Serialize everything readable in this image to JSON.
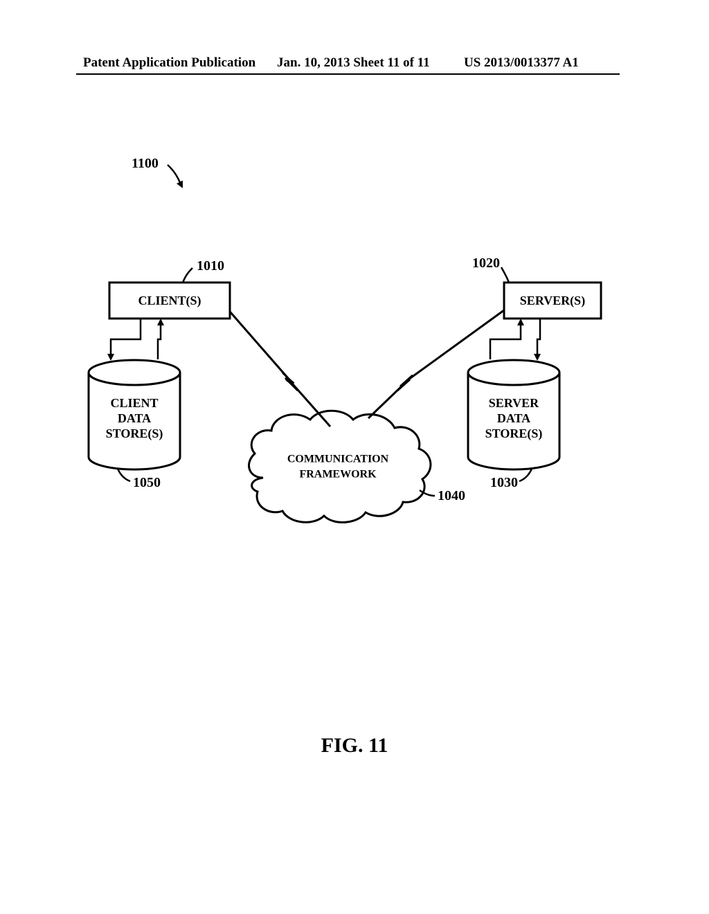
{
  "header": {
    "left": "Patent Application Publication",
    "mid": "Jan. 10, 2013  Sheet 11 of 11",
    "right": "US 2013/0013377 A1"
  },
  "figure": {
    "caption": "FIG.  11",
    "refs": {
      "overall": "1100",
      "client": "1010",
      "server": "1020",
      "server_data": "1030",
      "framework": "1040",
      "client_data": "1050"
    },
    "labels": {
      "client": "CLIENT(S)",
      "server": "SERVER(S)",
      "client_data_line1": "CLIENT",
      "client_data_line2": "DATA",
      "client_data_line3": "STORE(S)",
      "server_data_line1": "SERVER",
      "server_data_line2": "DATA",
      "server_data_line3": "STORE(S)",
      "framework_line1": "COMMUNICATION",
      "framework_line2": "FRAMEWORK"
    }
  }
}
